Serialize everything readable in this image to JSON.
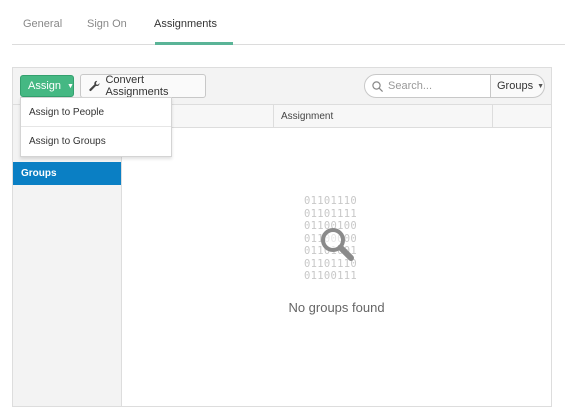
{
  "tabs": [
    {
      "label": "General",
      "active": false
    },
    {
      "label": "Sign On",
      "active": false
    },
    {
      "label": "Assignments",
      "active": true
    }
  ],
  "toolbar": {
    "assign_label": "Assign",
    "convert_label": "Convert Assignments",
    "search_placeholder": "Search...",
    "filter_selected": "Groups"
  },
  "dropdown": {
    "items": [
      "Assign to People",
      "Assign to Groups"
    ]
  },
  "table": {
    "columns": [
      "Assignment"
    ]
  },
  "sidebar": {
    "items": [
      {
        "label": "Groups",
        "selected": true
      }
    ]
  },
  "empty_state": {
    "binary_lines": [
      "01101110",
      "01101111",
      "01100100",
      "01100000",
      "01101001",
      "01101110",
      "01100111"
    ],
    "message": "No groups found",
    "icon": "magnifier-icon"
  },
  "colors": {
    "accent_green": "#45b883",
    "tab_underline": "#5ab497",
    "selected_blue": "#0a7fc4"
  }
}
